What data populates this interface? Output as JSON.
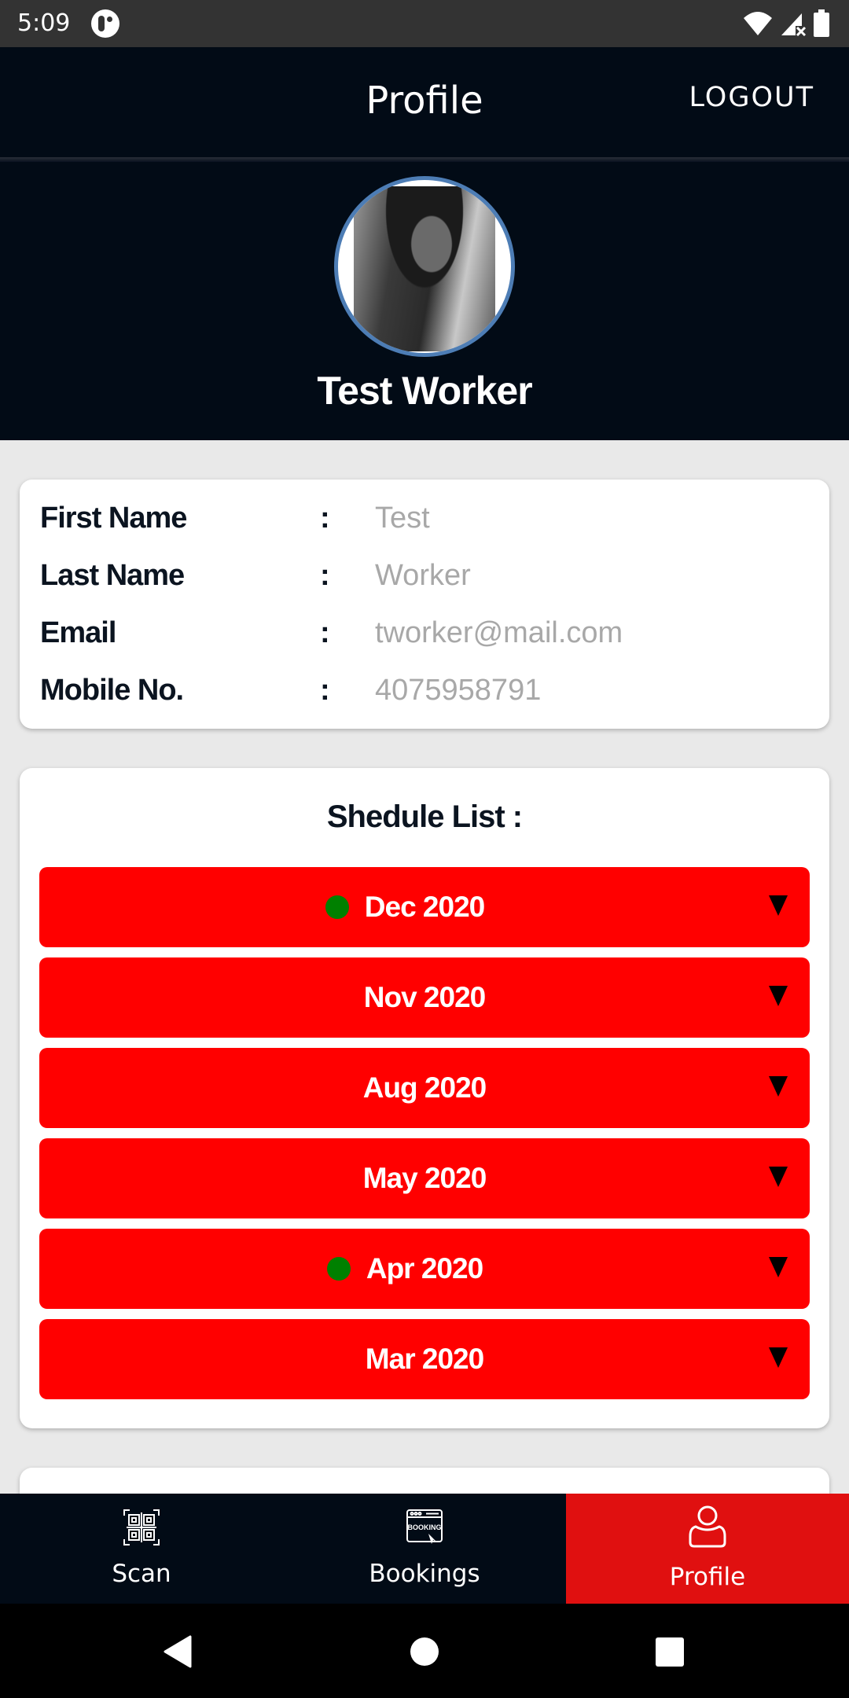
{
  "status_bar": {
    "time": "5:09",
    "icons": [
      "app-notification-icon",
      "wifi-icon",
      "signal-no-service-icon",
      "battery-icon"
    ]
  },
  "header": {
    "title": "Profile",
    "logout_label": "LOGOUT"
  },
  "profile": {
    "name": "Test Worker",
    "avatar_border_color": "#4d7db5"
  },
  "info": {
    "separator": ":",
    "rows": [
      {
        "label": "First Name",
        "value": "Test"
      },
      {
        "label": "Last Name",
        "value": "Worker"
      },
      {
        "label": "Email",
        "value": "tworker@mail.com"
      },
      {
        "label": "Mobile No.",
        "value": "4075958791"
      }
    ]
  },
  "schedule": {
    "title": "Shedule List :",
    "item_color": "#ff0000",
    "indicator_color": "#008000",
    "items": [
      {
        "label": "Dec 2020",
        "has_indicator": true
      },
      {
        "label": "Nov 2020",
        "has_indicator": false
      },
      {
        "label": "Aug 2020",
        "has_indicator": false
      },
      {
        "label": "May 2020",
        "has_indicator": false
      },
      {
        "label": "Apr 2020",
        "has_indicator": true
      },
      {
        "label": "Mar 2020",
        "has_indicator": false
      }
    ]
  },
  "bottom_nav": {
    "active_color": "#e01010",
    "items": [
      {
        "label": "Scan",
        "icon": "qr-scan-icon",
        "active": false
      },
      {
        "label": "Bookings",
        "icon": "booking-icon",
        "active": false
      },
      {
        "label": "Profile",
        "icon": "user-icon",
        "active": true
      }
    ]
  },
  "system_nav": {
    "buttons": [
      "back-icon",
      "home-icon",
      "recents-icon"
    ]
  }
}
